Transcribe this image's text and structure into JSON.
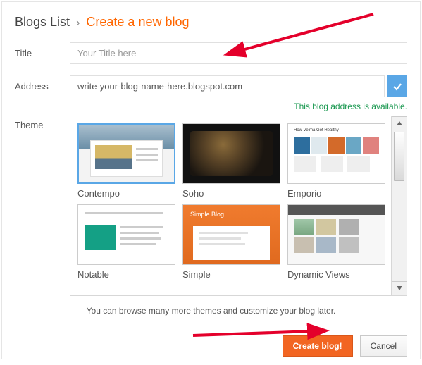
{
  "breadcrumb": {
    "root": "Blogs List",
    "current": "Create a new blog"
  },
  "labels": {
    "title": "Title",
    "address": "Address",
    "theme": "Theme"
  },
  "fields": {
    "title_value": "Your Title here",
    "address_value": "write-your-blog-name-here.blogspot.com"
  },
  "status": {
    "address_available": "This blog address is available."
  },
  "themes": [
    {
      "name": "Contempo",
      "selected": true
    },
    {
      "name": "Soho",
      "selected": false
    },
    {
      "name": "Emporio",
      "selected": false
    },
    {
      "name": "Notable",
      "selected": false
    },
    {
      "name": "Simple",
      "selected": false
    },
    {
      "name": "Dynamic Views",
      "selected": false
    }
  ],
  "helper_text": "You can browse many more themes and customize your blog later.",
  "buttons": {
    "create": "Create blog!",
    "cancel": "Cancel"
  },
  "theme_preview": {
    "emporio_heading": "How Velma Got Healthy",
    "simple_heading": "Simple Blog"
  }
}
